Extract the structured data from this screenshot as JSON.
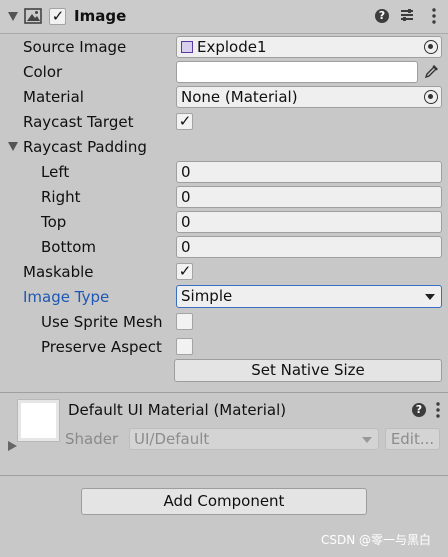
{
  "header": {
    "title": "Image",
    "enabled_check": "✓"
  },
  "properties": {
    "source_image": {
      "label": "Source Image",
      "value": "Explode1"
    },
    "color": {
      "label": "Color"
    },
    "material": {
      "label": "Material",
      "value": "None (Material)"
    },
    "raycast_target": {
      "label": "Raycast Target",
      "check": "✓"
    },
    "raycast_padding": {
      "label": "Raycast Padding",
      "left": {
        "label": "Left",
        "value": "0"
      },
      "right": {
        "label": "Right",
        "value": "0"
      },
      "top": {
        "label": "Top",
        "value": "0"
      },
      "bottom": {
        "label": "Bottom",
        "value": "0"
      }
    },
    "maskable": {
      "label": "Maskable",
      "check": "✓"
    },
    "image_type": {
      "label": "Image Type",
      "value": "Simple"
    },
    "use_sprite_mesh": {
      "label": "Use Sprite Mesh"
    },
    "preserve_aspect": {
      "label": "Preserve Aspect"
    },
    "set_native_size": "Set Native Size"
  },
  "material_section": {
    "title": "Default UI Material (Material)",
    "shader_label": "Shader",
    "shader_value": "UI/Default",
    "edit_label": "Edit..."
  },
  "add_component": "Add Component",
  "watermark": "CSDN @零一与黑白",
  "colors": {
    "accent_label": "#1d58b4",
    "field_bg": "#efefef",
    "panel_bg": "#c8c8c8"
  },
  "icons": [
    "foldout-arrow-icon",
    "image-component-icon",
    "help-icon",
    "presets-icon",
    "more-menu-icon",
    "target-icon",
    "eyedropper-icon",
    "dropdown-arrow-icon",
    "sprite-icon"
  ]
}
